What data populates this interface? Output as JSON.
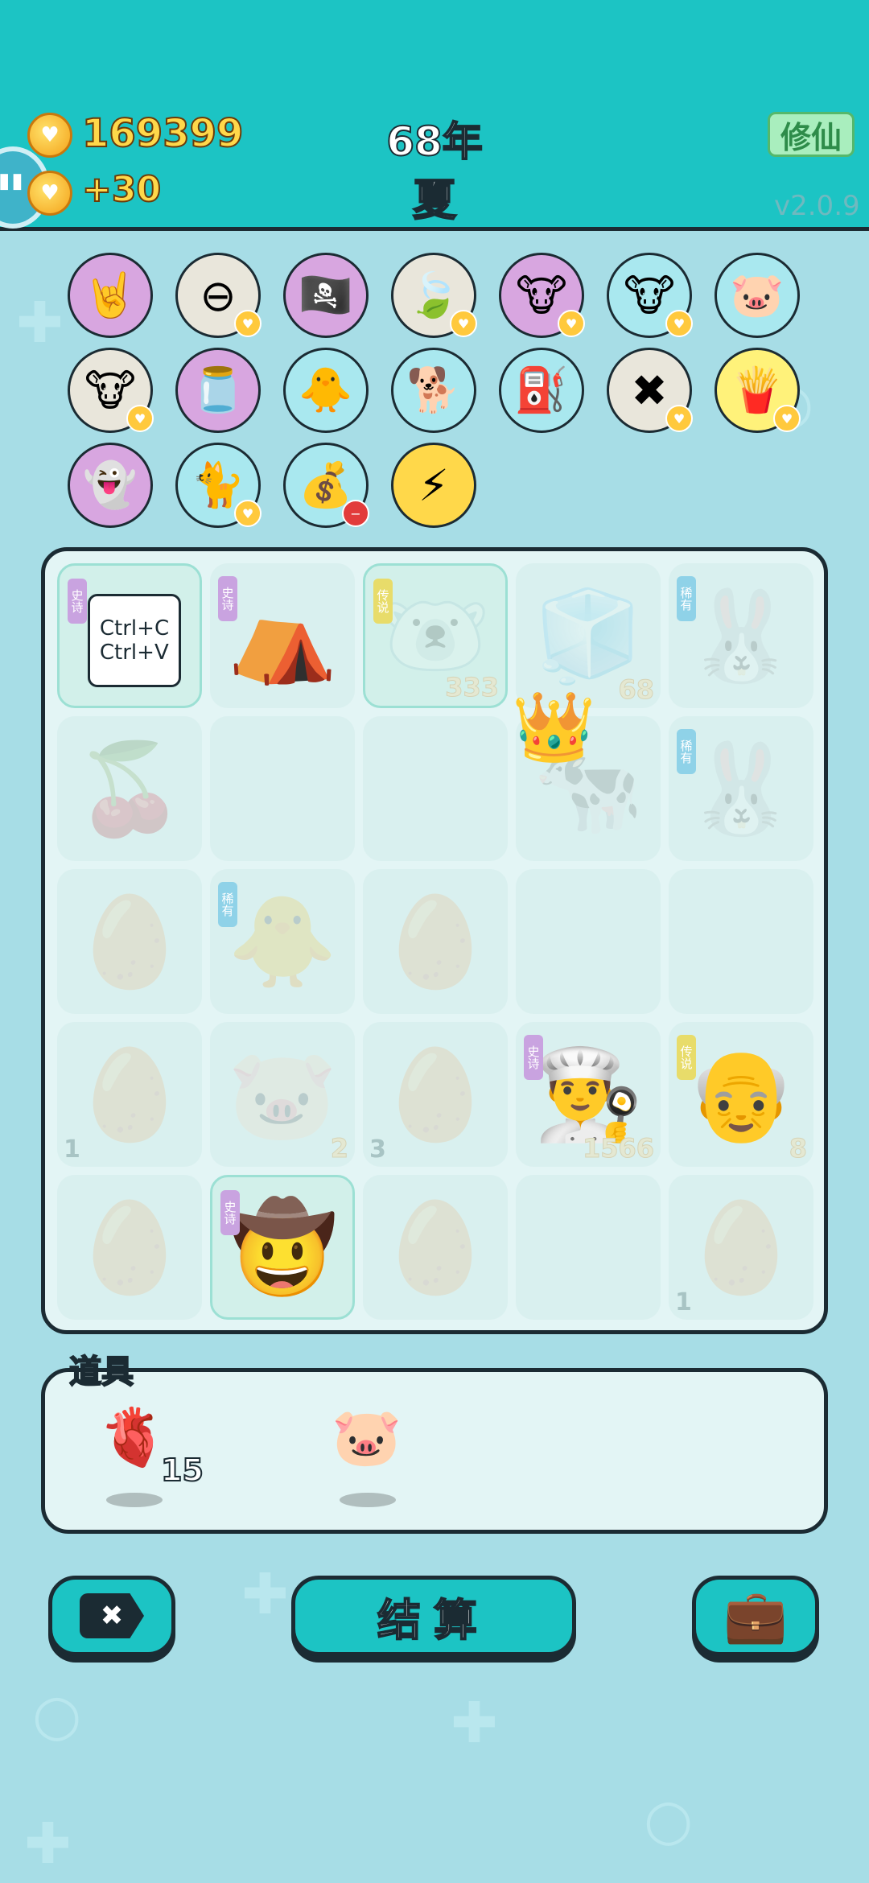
{
  "header": {
    "coins": "169399",
    "coin_gain": "+30",
    "year": "68年",
    "season": "夏",
    "cultivate_label": "修仙",
    "version": "v2.0.9"
  },
  "items": [
    {
      "name": "rock-hand",
      "icon": "🤘",
      "bg": "#d8a6e0"
    },
    {
      "name": "no-entry",
      "icon": "⊖",
      "bg": "#e9e6db",
      "badge": "yellow"
    },
    {
      "name": "eyepatch",
      "icon": "🏴‍☠️",
      "bg": "#d8a6e0"
    },
    {
      "name": "leaf",
      "icon": "🍃",
      "bg": "#e9e6db",
      "badge": "yellow"
    },
    {
      "name": "cow-pair",
      "icon": "🐮",
      "bg": "#d8a6e0",
      "badge": "yellow"
    },
    {
      "name": "cow-pair-2",
      "icon": "🐮",
      "bg": "#a9e8ef",
      "badge": "yellow"
    },
    {
      "name": "piggy-bank",
      "icon": "🐷",
      "bg": "#a9e8ef"
    },
    {
      "name": "cow-pair-3",
      "icon": "🐮",
      "bg": "#e9e6db",
      "badge": "yellow"
    },
    {
      "name": "jar",
      "icon": "🫙",
      "bg": "#d8a6e0"
    },
    {
      "name": "chick-egg",
      "icon": "🐥",
      "bg": "#a9e8ef"
    },
    {
      "name": "cool-dog",
      "icon": "🐕",
      "bg": "#a9e8ef"
    },
    {
      "name": "air-pump",
      "icon": "⛽",
      "bg": "#a9e8ef"
    },
    {
      "name": "remove-tag",
      "icon": "✖",
      "bg": "#e9e6db",
      "badge": "yellow"
    },
    {
      "name": "fries",
      "icon": "🍟",
      "bg": "#fff27a",
      "badge": "yellow"
    },
    {
      "name": "ghost",
      "icon": "👻",
      "bg": "#d8a6e0"
    },
    {
      "name": "cat",
      "icon": "🐈",
      "bg": "#a9e8ef",
      "badge": "yellow"
    },
    {
      "name": "sack",
      "icon": "💰",
      "bg": "#a9e8ef",
      "badge": "red"
    },
    {
      "name": "lightning",
      "icon": "⚡",
      "bg": "#ffd84a"
    }
  ],
  "board": [
    {
      "icon": "📋",
      "text": "Ctrl+C\nCtrl+V",
      "faded": false,
      "hl": true,
      "rarity": "史诗",
      "rarity_color": "#c9a3e0"
    },
    {
      "icon": "⛺",
      "faded": false,
      "rarity": "史诗",
      "rarity_color": "#c9a3e0"
    },
    {
      "icon": "🐻‍❄️",
      "faded": true,
      "hl": true,
      "rarity": "传说",
      "rarity_color": "#e8dc6a",
      "count": "333"
    },
    {
      "icon": "🧊",
      "faded": true,
      "count": "68"
    },
    {
      "icon": "🐰",
      "faded": true,
      "rarity": "稀有",
      "rarity_color": "#8fd2e8"
    },
    {
      "icon": "🍒",
      "faded": true
    },
    {
      "icon": "",
      "faded": true
    },
    {
      "icon": "",
      "faded": true
    },
    {
      "icon": "🐄",
      "faded": true,
      "crown": true
    },
    {
      "icon": "🐰",
      "faded": true,
      "rarity": "稀有",
      "rarity_color": "#8fd2e8"
    },
    {
      "icon": "🥚",
      "faded": true
    },
    {
      "icon": "🐥",
      "faded": true,
      "rarity": "稀有",
      "rarity_color": "#8fd2e8"
    },
    {
      "icon": "🥚",
      "faded": true
    },
    {
      "icon": "",
      "faded": true
    },
    {
      "icon": "",
      "faded": true
    },
    {
      "icon": "🥚",
      "faded": true,
      "count_left": "1"
    },
    {
      "icon": "🐷",
      "faded": true,
      "count": "2"
    },
    {
      "icon": "🥚",
      "faded": true,
      "count_left": "3"
    },
    {
      "icon": "👨‍🍳",
      "faded": false,
      "rarity": "史诗",
      "rarity_color": "#c9a3e0",
      "count": "1566"
    },
    {
      "icon": "👴",
      "faded": false,
      "rarity": "传说",
      "rarity_color": "#e8dc6a",
      "count": "8"
    },
    {
      "icon": "🥚",
      "faded": true
    },
    {
      "icon": "🤠",
      "faded": false,
      "hl": true,
      "rarity": "史诗",
      "rarity_color": "#c9a3e0"
    },
    {
      "icon": "🥚",
      "faded": true
    },
    {
      "icon": "",
      "faded": true
    },
    {
      "icon": "🥚",
      "faded": true,
      "count_left": "1"
    }
  ],
  "props": {
    "label": "道具",
    "items": [
      {
        "name": "liver",
        "icon": "🫀",
        "count": "15"
      },
      {
        "name": "piggy-bank",
        "icon": "🐷",
        "count": ""
      }
    ]
  },
  "buttons": {
    "remove_icon": "✖",
    "settle_label": "结算",
    "bag_icon": "💼"
  },
  "colors": {
    "header": "#1cc4c4",
    "board_bg": "#e3f5f5",
    "outline": "#1b2b33",
    "gold": "#ffd84a"
  }
}
